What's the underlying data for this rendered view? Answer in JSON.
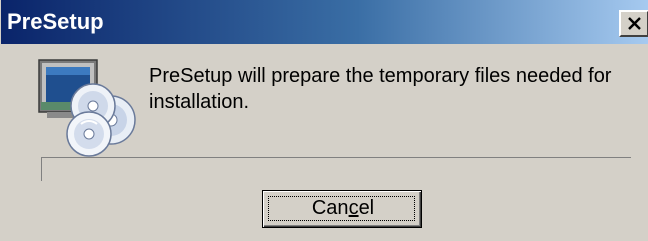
{
  "window": {
    "title": "PreSetup",
    "close_glyph": "×",
    "accent_color": "#0a246a",
    "face_color": "#d4d0c8"
  },
  "body": {
    "icon": "setup-discs-icon",
    "message": "PreSetup will prepare the temporary files needed for installation.",
    "progress": 0
  },
  "buttons": {
    "cancel_pre": "Can",
    "cancel_mnemonic": "c",
    "cancel_post": "el"
  }
}
